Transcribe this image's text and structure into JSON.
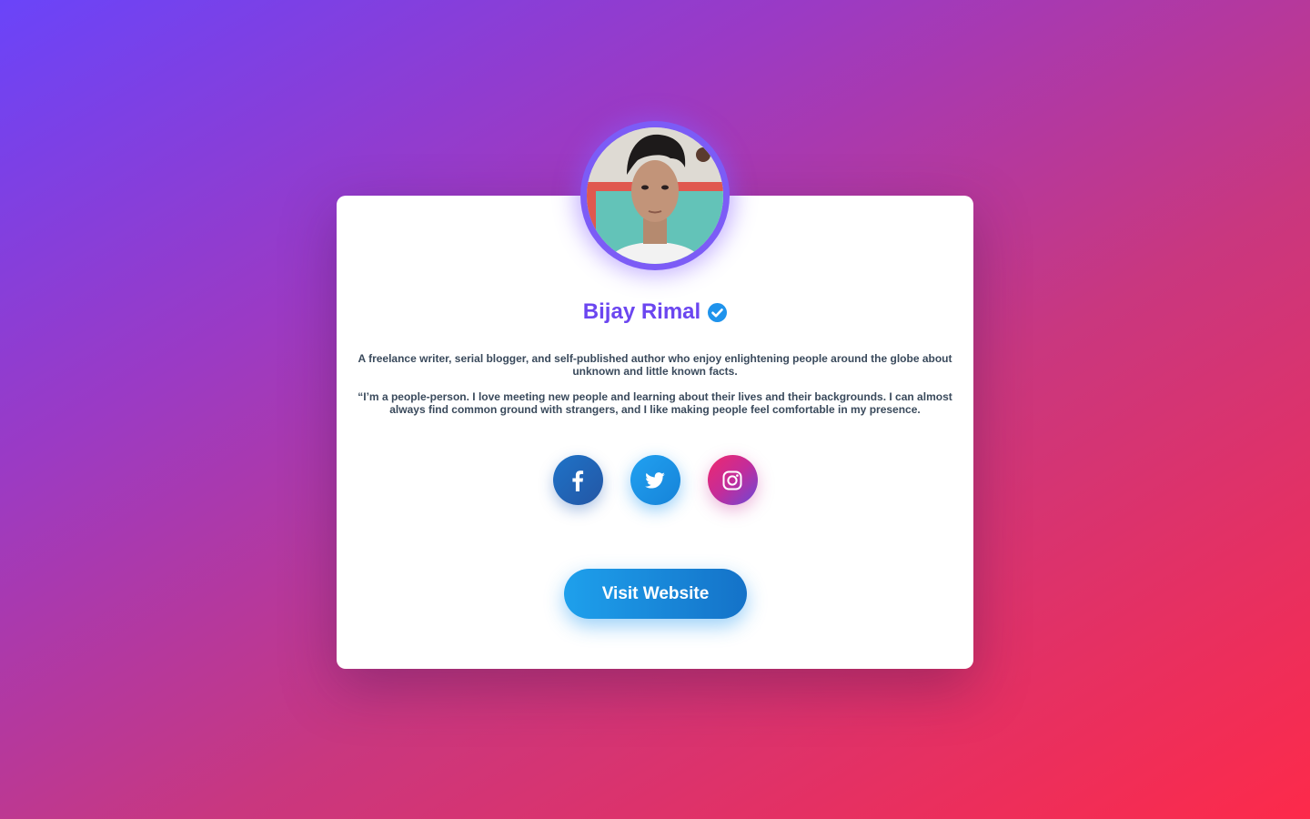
{
  "profile": {
    "name": "Bijay Rimal",
    "verified_icon": "verified-check-icon",
    "avatar_alt": "profile photo"
  },
  "bio": {
    "paragraph_1": "A freelance writer, serial blogger, and self-published author who enjoy enlightening people around the globe about unknown and little known facts.",
    "paragraph_2": "“I’m a people-person. I love meeting new people and learning about their lives and their backgrounds. I can almost always find common ground with strangers, and I like making people feel comfortable in my presence."
  },
  "socials": [
    {
      "name": "facebook",
      "icon": "facebook-icon"
    },
    {
      "name": "twitter",
      "icon": "twitter-icon"
    },
    {
      "name": "instagram",
      "icon": "instagram-icon"
    }
  ],
  "cta": {
    "label": "Visit Website"
  },
  "colors": {
    "name": "#6b46f0",
    "avatar_ring": "#7c5cf6",
    "text": "#3a4a5c",
    "button": "#1ea0ec",
    "bg_start": "#6a44f9",
    "bg_end": "#fd2a4a"
  }
}
